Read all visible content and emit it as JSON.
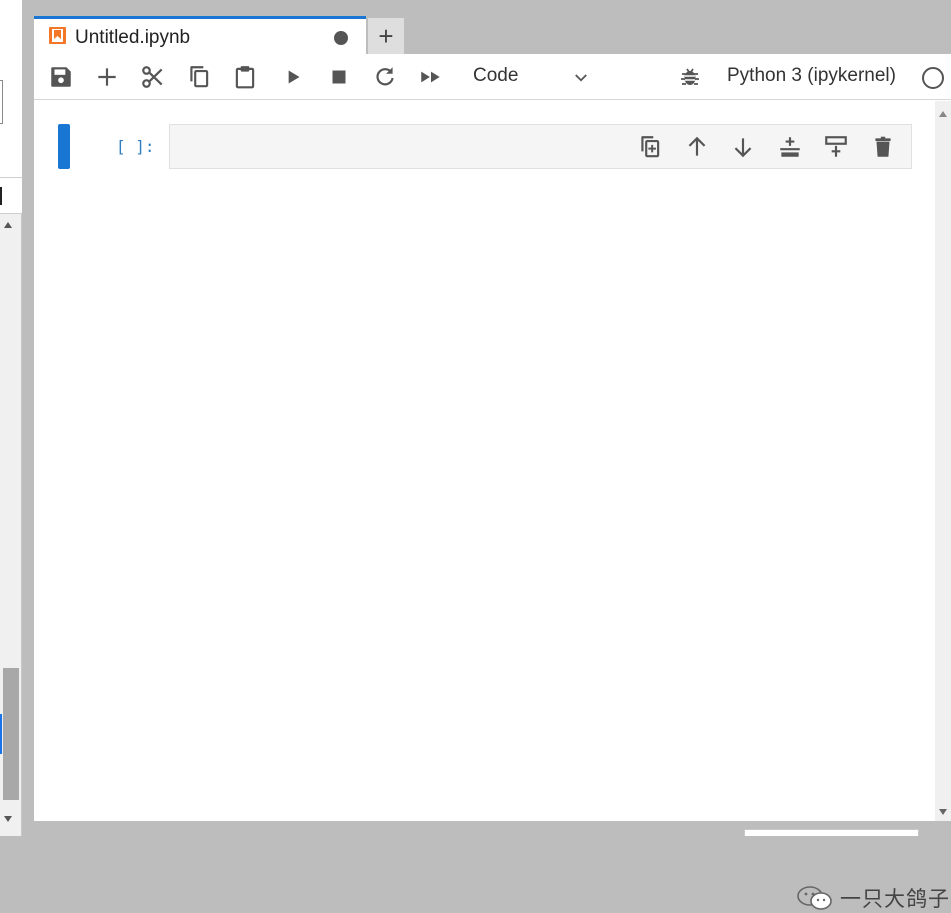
{
  "tab": {
    "title": "Untitled.ipynb",
    "icon": "notebook-icon",
    "dirty": true,
    "new_tab_label": "+"
  },
  "toolbar": {
    "buttons": [
      {
        "name": "save",
        "icon": "save-icon"
      },
      {
        "name": "insert-cell",
        "icon": "plus-icon"
      },
      {
        "name": "cut",
        "icon": "scissors-icon"
      },
      {
        "name": "copy",
        "icon": "copy-icon"
      },
      {
        "name": "paste",
        "icon": "paste-icon"
      },
      {
        "name": "run",
        "icon": "play-icon"
      },
      {
        "name": "interrupt",
        "icon": "stop-icon"
      },
      {
        "name": "restart",
        "icon": "refresh-icon"
      },
      {
        "name": "restart-run-all",
        "icon": "fast-forward-icon"
      }
    ],
    "cell_type": "Code",
    "kernel_name": "Python 3 (ipykernel)",
    "kernel_status": "idle"
  },
  "cell": {
    "prompt": "[ ]:",
    "content": "",
    "tools": [
      "duplicate-icon",
      "move-up-icon",
      "move-down-icon",
      "insert-above-icon",
      "insert-below-icon",
      "delete-icon"
    ]
  },
  "watermark": {
    "text": "一只大鸽子"
  },
  "colors": {
    "accent": "#1976d2",
    "notebook_icon": "#f37726",
    "prompt": "#307fc1"
  }
}
